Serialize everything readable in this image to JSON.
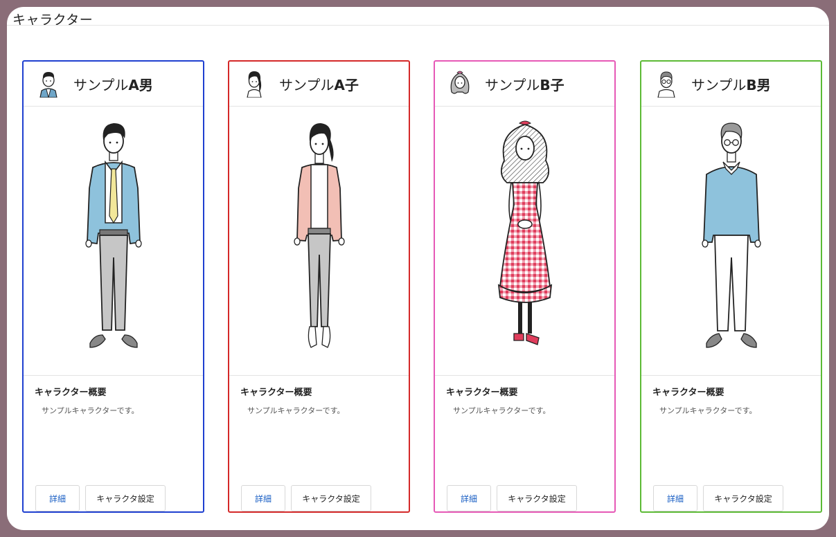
{
  "page": {
    "title": "キャラクター"
  },
  "cards": [
    {
      "name_prefix": "サンプル",
      "name_suffix": "A男",
      "border_color": "#1e3fd0",
      "summary_title": "キャラクター概要",
      "summary_text": "サンプルキャラクターです。",
      "detail_label": "詳細",
      "settings_label": "キャラクタ設定",
      "avatar_icon": "man-avatar-icon"
    },
    {
      "name_prefix": "サンプル",
      "name_suffix": "A子",
      "border_color": "#d42828",
      "summary_title": "キャラクター概要",
      "summary_text": "サンプルキャラクターです。",
      "detail_label": "詳細",
      "settings_label": "キャラクタ設定",
      "avatar_icon": "woman-avatar-icon"
    },
    {
      "name_prefix": "サンプル",
      "name_suffix": "B子",
      "border_color": "#e658b6",
      "summary_title": "キャラクター概要",
      "summary_text": "サンプルキャラクターです。",
      "detail_label": "詳細",
      "settings_label": "キャラクタ設定",
      "avatar_icon": "girl-avatar-icon"
    },
    {
      "name_prefix": "サンプル",
      "name_suffix": "B男",
      "border_color": "#5cba35",
      "summary_title": "キャラクター概要",
      "summary_text": "サンプルキャラクターです。",
      "detail_label": "詳細",
      "settings_label": "キャラクタ設定",
      "avatar_icon": "old-man-avatar-icon"
    }
  ]
}
